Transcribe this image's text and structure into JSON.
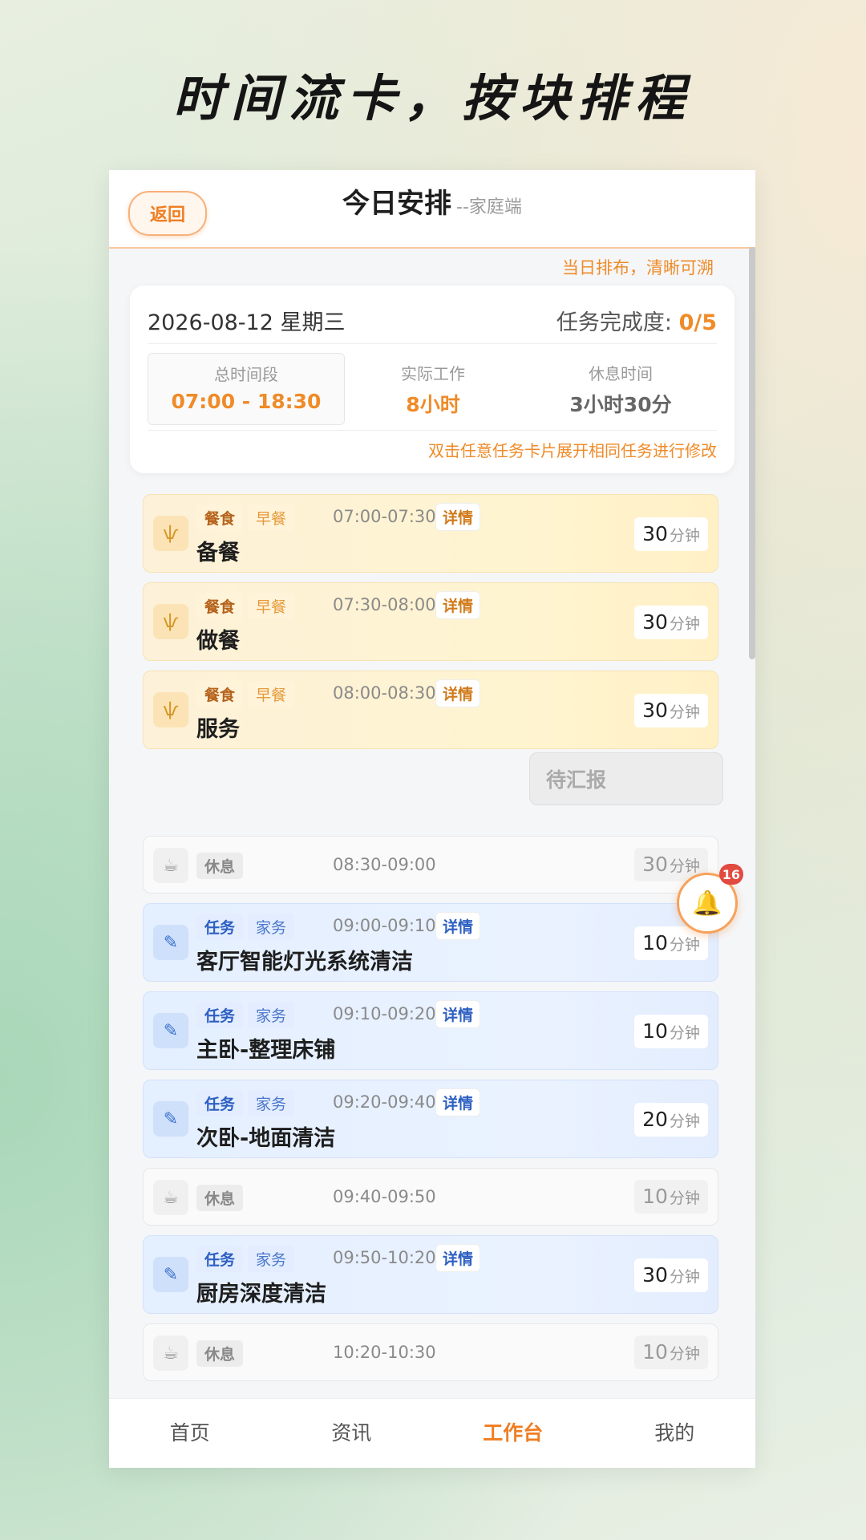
{
  "slogan": "时间流卡，按块排程",
  "header": {
    "back_label": "返回",
    "title": "今日安排",
    "subtitle": "--家庭端"
  },
  "top_hint": "当日排布，清晰可溯",
  "summary": {
    "date": "2026-08-12 星期三",
    "progress_label": "任务完成度: ",
    "progress_value": "0/5",
    "stats": [
      {
        "label": "总时间段",
        "value": "07:00 - 18:30",
        "color": "#ef8b28"
      },
      {
        "label": "实际工作",
        "value": "8小时",
        "color": "#ef8b28"
      },
      {
        "label": "休息时间",
        "value": "3小时30分",
        "color": "#666666"
      }
    ],
    "hint": "双击任意任务卡片展开相同任务进行修改"
  },
  "cards": [
    {
      "kind": "meal",
      "icon": "utensils-icon",
      "tag1": "餐食",
      "tag2": "早餐",
      "time": "07:00-07:30",
      "detail": "详情",
      "name": "备餐",
      "dur": "30",
      "unit": "分钟"
    },
    {
      "kind": "meal",
      "icon": "utensils-icon",
      "tag1": "餐食",
      "tag2": "早餐",
      "time": "07:30-08:00",
      "detail": "详情",
      "name": "做餐",
      "dur": "30",
      "unit": "分钟"
    },
    {
      "kind": "meal",
      "icon": "utensils-icon",
      "tag1": "餐食",
      "tag2": "早餐",
      "time": "08:00-08:30",
      "detail": "详情",
      "name": "服务",
      "dur": "30",
      "unit": "分钟"
    },
    {
      "kind": "rest",
      "icon": "coffee-cup-icon",
      "tag1": "休息",
      "time": "08:30-09:00",
      "dur": "30",
      "unit": "分钟"
    },
    {
      "kind": "task",
      "icon": "pencil-icon",
      "tag1": "任务",
      "tag2": "家务",
      "time": "09:00-09:10",
      "detail": "详情",
      "name": "客厅智能灯光系统清洁",
      "dur": "10",
      "unit": "分钟"
    },
    {
      "kind": "task",
      "icon": "pencil-icon",
      "tag1": "任务",
      "tag2": "家务",
      "time": "09:10-09:20",
      "detail": "详情",
      "name": "主卧-整理床铺",
      "dur": "10",
      "unit": "分钟"
    },
    {
      "kind": "task",
      "icon": "pencil-icon",
      "tag1": "任务",
      "tag2": "家务",
      "time": "09:20-09:40",
      "detail": "详情",
      "name": "次卧-地面清洁",
      "dur": "20",
      "unit": "分钟"
    },
    {
      "kind": "rest",
      "icon": "coffee-cup-icon",
      "tag1": "休息",
      "time": "09:40-09:50",
      "dur": "10",
      "unit": "分钟"
    },
    {
      "kind": "task",
      "icon": "pencil-icon",
      "tag1": "任务",
      "tag2": "家务",
      "time": "09:50-10:20",
      "detail": "详情",
      "name": "厨房深度清洁",
      "dur": "30",
      "unit": "分钟"
    },
    {
      "kind": "rest",
      "icon": "coffee-cup-icon",
      "tag1": "休息",
      "time": "10:20-10:30",
      "dur": "10",
      "unit": "分钟"
    }
  ],
  "pending_label": "待汇报",
  "notification": {
    "icon": "bell-icon",
    "count": "16"
  },
  "tabs": [
    {
      "label": "首页",
      "active": false
    },
    {
      "label": "资讯",
      "active": false
    },
    {
      "label": "工作台",
      "active": true
    },
    {
      "label": "我的",
      "active": false
    }
  ]
}
